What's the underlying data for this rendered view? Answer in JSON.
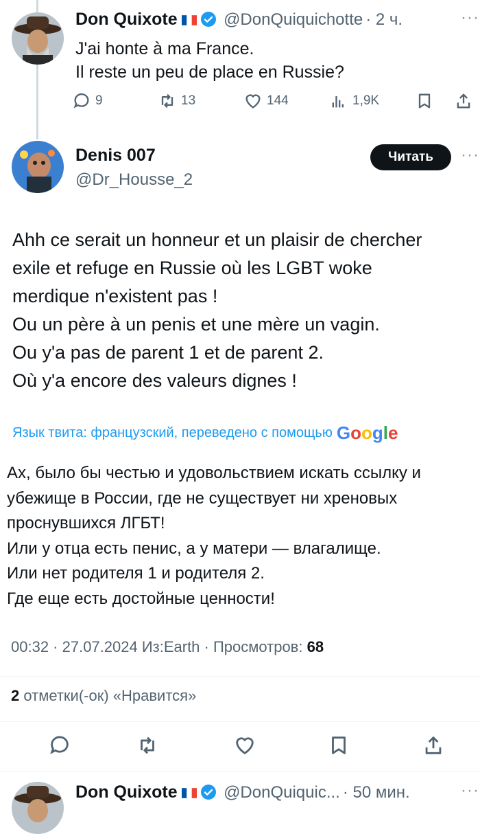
{
  "tweet1": {
    "name": "Don Quixote",
    "handle": "@DonQuiquichotte",
    "time": "· 2 ч.",
    "lines": [
      "J'ai honte à ma France.",
      "Il reste un peu de place en Russie?"
    ],
    "replies": "9",
    "retweets": "13",
    "likes": "144",
    "views": "1,9K"
  },
  "tweet2": {
    "name": "Denis 007",
    "handle": "@Dr_Housse_2",
    "follow_label": "Читать",
    "lines": [
      "Ahh ce serait un honneur et un plaisir de chercher",
      "exile et refuge en Russie où les LGBT woke",
      "merdique n'existent pas !",
      "Ou un père à un penis et une mère un vagin.",
      "Ou y'a pas de parent 1 et de parent 2.",
      "Où y'a encore des valeurs dignes !"
    ],
    "translate_label": "Язык твита: французский, переведено с помощью",
    "translate_brand": [
      "G",
      "o",
      "o",
      "g",
      "l",
      "e"
    ],
    "translation_lines": [
      "Ах, было бы честью и удовольствием искать ссылку и",
      "убежище в России, где не существует ни хреновых",
      "проснувшихся ЛГБТ!",
      "Или у отца есть пенис, а у матери — влагалище.",
      "Или нет родителя 1 и родителя 2.",
      "Где еще есть достойные ценности!"
    ],
    "meta": "00:32 · 27.07.2024 Из:Earth · Просмотров: ",
    "views": "68",
    "likes_count": "2",
    "likes_label": "отметки(-ок) «Нравится»"
  },
  "tweet3": {
    "name": "Don Quixote",
    "handle": "@DonQuiquic...",
    "time": "· 50 мин."
  },
  "colors": {
    "accent": "#1d9bf0",
    "text": "#0f1419",
    "muted": "#536471"
  }
}
